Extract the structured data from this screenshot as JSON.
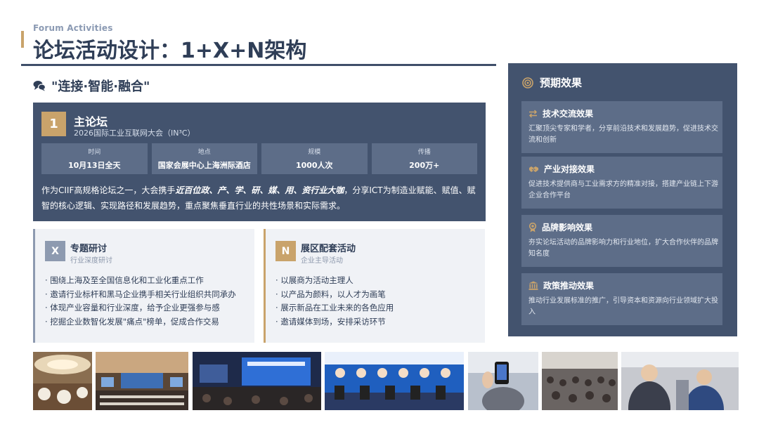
{
  "header": {
    "en_subtitle": "Forum Activities",
    "title": "论坛活动设计：1+X+N架构"
  },
  "slogan": {
    "icon": "chat-bubbles-icon",
    "text": "\"连接·智能·融合\""
  },
  "main_forum": {
    "number": "1",
    "title": "主论坛",
    "subtitle": "2026国际工业互联网大会（IN³C）",
    "stats": [
      {
        "label": "时间",
        "value": "10月13日全天"
      },
      {
        "label": "地点",
        "value": "国家会展中心上海洲际酒店"
      },
      {
        "label": "规模",
        "value": "1000人次"
      },
      {
        "label": "传播",
        "value": "200万+"
      }
    ],
    "desc_before": "作为CIIF高规格论坛之一，大会携手",
    "desc_emphasis": "近百位政、产、学、研、媒、用、资行业大咖",
    "desc_after": "，分享ICT为制造业赋能、赋值、赋智的核心逻辑、实现路径和发展趋势，重点聚焦垂直行业的共性场景和实际需求。"
  },
  "x_card": {
    "badge": "X",
    "title": "专题研讨",
    "subtitle": "行业深度研讨",
    "items": [
      "· 围绕上海及至全国信息化和工业化重点工作",
      "· 邀请行业标杆和黑马企业携手相关行业组织共同承办",
      "· 体现产业容量和行业深度，给予企业更强参与感",
      "· 挖掘企业数智化发展\"痛点\"榜单，促成合作交易"
    ]
  },
  "n_card": {
    "badge": "N",
    "title": "展区配套活动",
    "subtitle": "企业主导活动",
    "items": [
      "· 以展商为活动主理人",
      "· 以产品为颜料，以人才为画笔",
      "· 展示新品在工业未来的各色应用",
      "· 邀请媒体到场，安排采访环节"
    ]
  },
  "effects": {
    "icon": "target-icon",
    "title": "预期效果",
    "items": [
      {
        "icon": "exchange-arrows-icon",
        "title": "技术交流效果",
        "desc": "汇聚顶尖专家和学者，分享前沿技术和发展趋势，促进技术交流和创新"
      },
      {
        "icon": "handshake-icon",
        "title": "产业对接效果",
        "desc": "促进技术提供商与工业需求方的精准对接，搭建产业链上下游企业合作平台"
      },
      {
        "icon": "award-icon",
        "title": "品牌影响效果",
        "desc": "夯实论坛活动的品牌影响力和行业地位，扩大合作伙伴的品牌知名度"
      },
      {
        "icon": "government-building-icon",
        "title": "政策推动效果",
        "desc": "推动行业发展标准的推广，引导资本和资源向行业领域扩大投入"
      }
    ]
  },
  "colors": {
    "navy": "#43536e",
    "navy_light": "#5d6d88",
    "gold": "#c9a36b",
    "text": "#2f3e57",
    "card_bg": "#f0f2f6"
  }
}
